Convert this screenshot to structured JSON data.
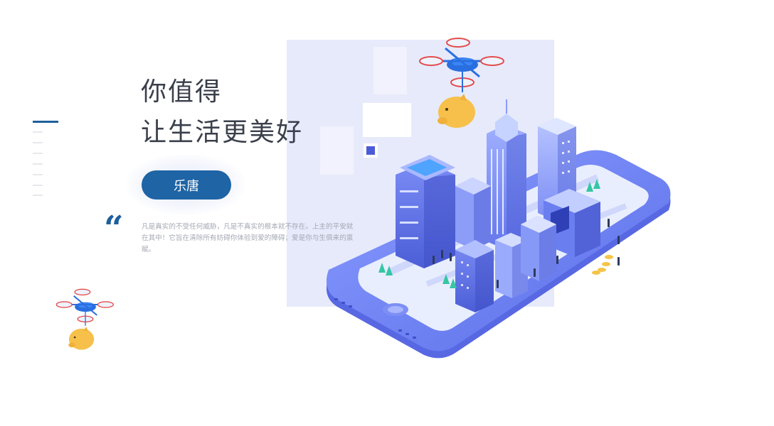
{
  "hero": {
    "headline_line1": "你值得",
    "headline_line2": "让生活更美好",
    "cta_label": "乐唐",
    "description": "凡是真实的不受任何威胁，凡是不真实的根本就不存在。上主的平安就在其中！它旨在清除所有妨碍你体验到爱的障碍；爱是你与生俱来的禀赋。"
  },
  "colors": {
    "accent": "#1f64a5",
    "headline": "#3a3f4b",
    "body_text": "#a3a8b3",
    "panel": "#e7eafb",
    "illustration_primary": "#6a7df0"
  },
  "icons": {
    "quote": "quote-icon",
    "drone_with_piggy_bank": "drone-piggy-bank-icon",
    "phone_city": "phone-city-illustration"
  }
}
